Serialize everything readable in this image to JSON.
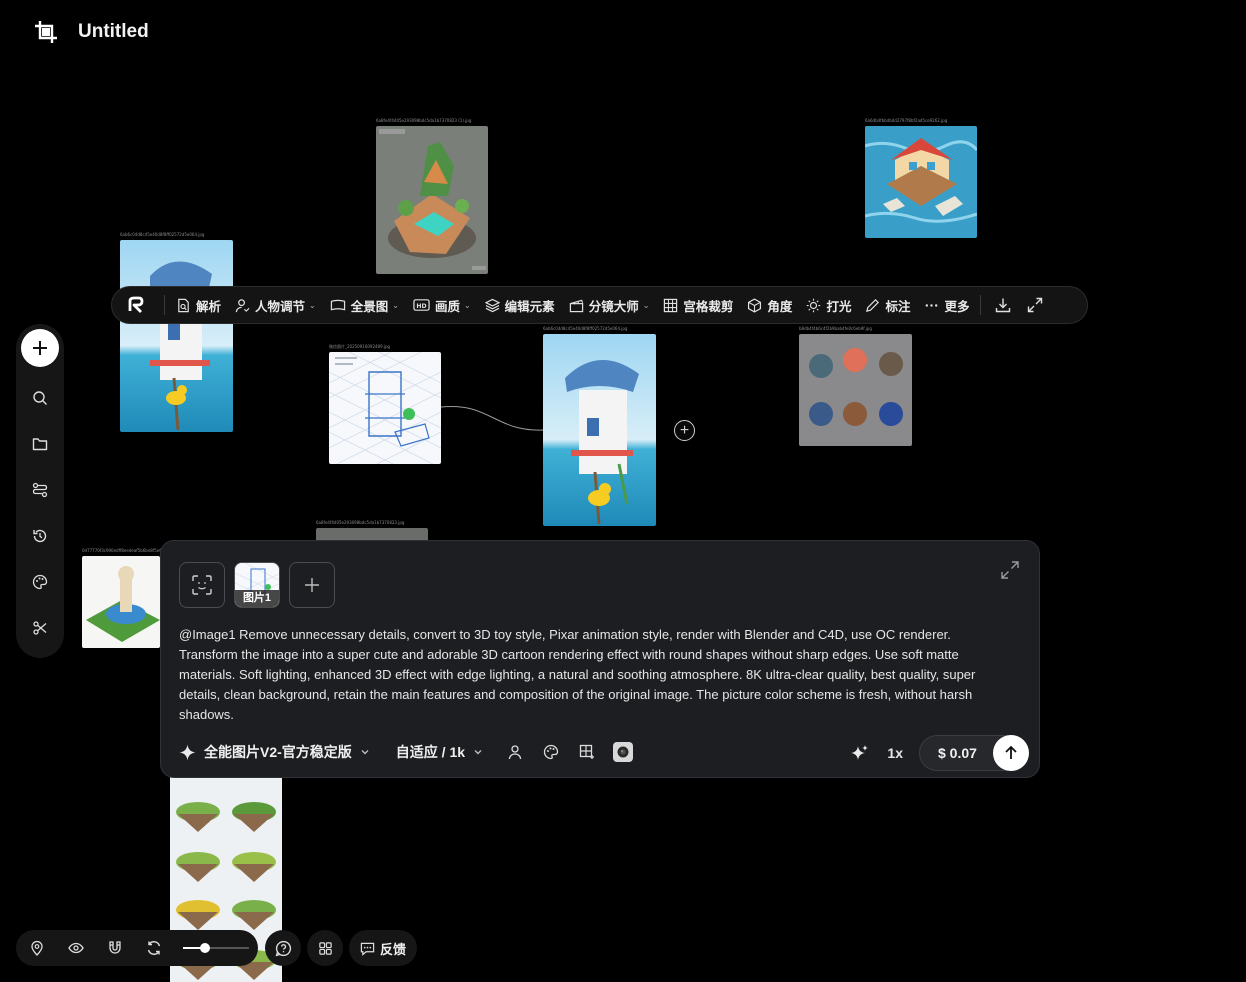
{
  "header": {
    "title": "Untitled"
  },
  "canvas": {
    "nodes": [
      {
        "id": "n-island",
        "caption": "6a8fe4f4d05e293098bdc5da1b7370823 (1).jpg"
      },
      {
        "id": "n-house",
        "caption": "6a6db4fbbdb4d2797f8bf2ad5ce9262.jpg"
      },
      {
        "id": "n-shark-left",
        "caption": "6ab6c04d8c45e40d8f8ff02572d5e064.jpg"
      },
      {
        "id": "n-sketch",
        "caption": "微信图片_20250916092489.jpg"
      },
      {
        "id": "n-shark-center",
        "caption": "6ab6c04d8c45e40d8f8ff02572d5e064.jpg"
      },
      {
        "id": "n-items",
        "caption": "b8db4f4b6c4f2b9bab4fe0c6eb9f.jpg"
      },
      {
        "id": "n-fountain",
        "caption": "0d77770f3c990edff8eedeaf5b6be8f5e6f.jpg"
      },
      {
        "id": "n-partial",
        "caption": "6a8fe4f4d05e293098bdc5da1b7370823.jpg"
      }
    ]
  },
  "toolbar": {
    "items": [
      {
        "label": "解析",
        "icon": "analyze-icon"
      },
      {
        "label": "人物调节",
        "icon": "person-icon",
        "dropdown": true
      },
      {
        "label": "全景图",
        "icon": "panorama-icon",
        "dropdown": true
      },
      {
        "label": "画质",
        "icon": "hd-icon",
        "dropdown": true
      },
      {
        "label": "编辑元素",
        "icon": "layers-icon"
      },
      {
        "label": "分镜大师",
        "icon": "clapper-icon",
        "dropdown": true
      },
      {
        "label": "宫格裁剪",
        "icon": "grid-icon"
      },
      {
        "label": "角度",
        "icon": "cube-icon"
      },
      {
        "label": "打光",
        "icon": "sun-icon"
      },
      {
        "label": "标注",
        "icon": "pen-icon"
      },
      {
        "label": "更多",
        "icon": "more-icon"
      }
    ]
  },
  "prompt_panel": {
    "reference_label": "图片1",
    "prompt": "@Image1 Remove unnecessary details, convert to 3D toy style, Pixar animation style, render with Blender and C4D, use OC renderer. Transform the image into a super cute and adorable 3D cartoon rendering effect with round shapes without sharp edges. Use soft matte materials. Soft lighting, enhanced 3D effect with edge lighting, a natural and soothing atmosphere. 8K ultra-clear quality, best quality, super details, clean background, retain the main features and composition of the original image. The picture color scheme is fresh, without harsh shadows.",
    "model": "全能图片V2-官方稳定版",
    "size": "自适应 / 1k",
    "multiplier": "1x",
    "price": "$ 0.07"
  },
  "bottom": {
    "zoom_fraction": 0.33,
    "feedback_label": "反馈"
  },
  "colors": {
    "background": "#000000",
    "panel": "#1c1e21",
    "toolbar": "#141414"
  }
}
